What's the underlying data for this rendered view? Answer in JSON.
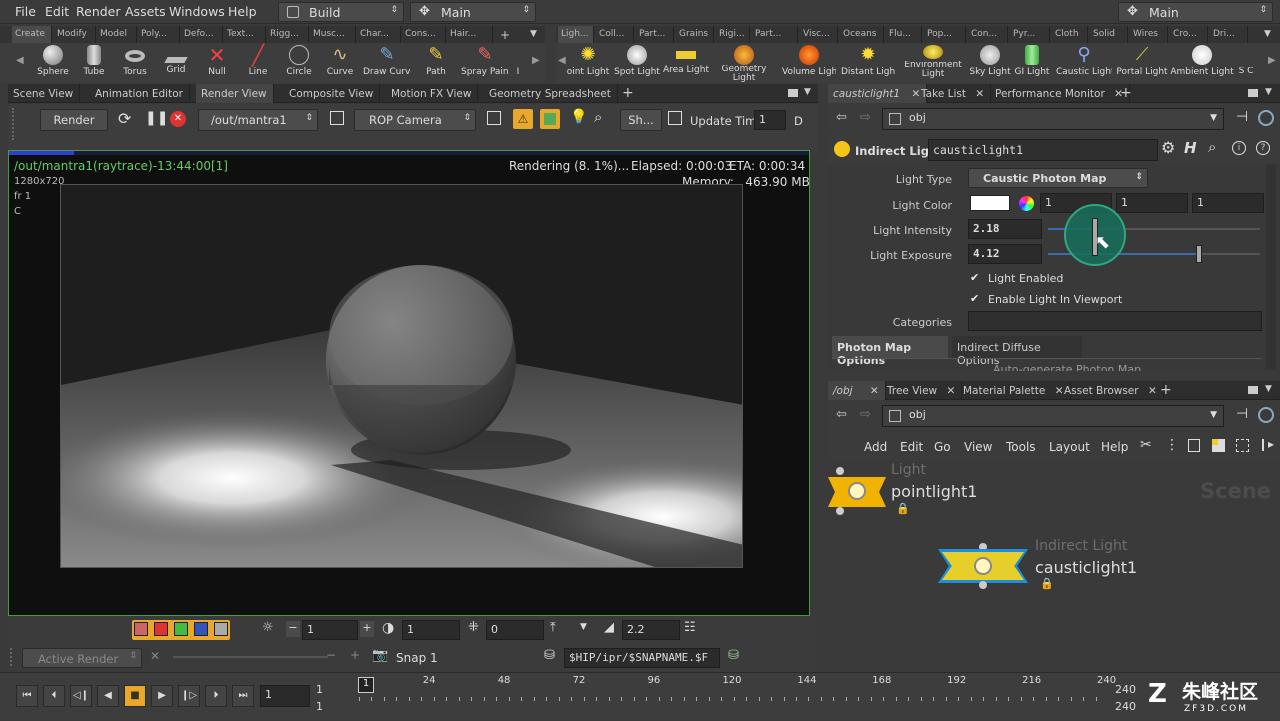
{
  "menubar": {
    "items": [
      "File",
      "Edit",
      "Render",
      "Assets",
      "Windows",
      "Help"
    ],
    "desktop1": "Build",
    "desktop2": "Main",
    "desktop3": "Main"
  },
  "shelf_left": {
    "tabs": [
      "Create",
      "Modify",
      "Model",
      "Poly...",
      "Defo...",
      "Text...",
      "Rigg...",
      "Musc...",
      "Char...",
      "Cons...",
      "Hair..."
    ],
    "tools": [
      "Sphere",
      "Tube",
      "Torus",
      "Grid",
      "Null",
      "Line",
      "Circle",
      "Curve",
      "Draw Curve",
      "Path",
      "Spray Paint",
      "I"
    ]
  },
  "shelf_right": {
    "tabs": [
      "Ligh...",
      "Coll...",
      "Part...",
      "Grains",
      "Rigi...",
      "Part...",
      "Visc...",
      "Oceans",
      "Flu...",
      "Pop...",
      "Con...",
      "Pyr...",
      "Cloth",
      "Solid",
      "Wires",
      "Cro...",
      "Dri..."
    ],
    "tools": [
      "oint Light",
      "Spot Light",
      "Area Light",
      "Geometry Light",
      "Volume Light",
      "Distant Light",
      "Environment Light",
      "Sky Light",
      "GI Light",
      "Caustic Light",
      "Portal Light",
      "Ambient Light",
      "S C"
    ]
  },
  "left_tabs": [
    "Scene View",
    "Animation Editor",
    "Render View",
    "Composite View",
    "Motion FX View",
    "Geometry Spreadsheet"
  ],
  "render_toolbar": {
    "render_btn": "Render",
    "rop_path": "/out/mantra1",
    "camera": "ROP Camera",
    "sh_btn": "Sh...",
    "update_time_label": "Update Time",
    "update_time_value": "1",
    "d_label": "D"
  },
  "render_view": {
    "title": "/out/mantra1(raytrace)-13:44:00[1]",
    "resolution": "1280x720",
    "frame": "fr 1",
    "channel": "C",
    "status": "Rendering (8. 1%)...",
    "elapsed": "Elapsed: 0:00:03",
    "eta": "ETA: 0:00:34",
    "memory": "Memory:   463.90 MB",
    "progress": 0.081
  },
  "render_bottom": {
    "val1": "1",
    "val2": "1",
    "val3": "0",
    "gamma": "2.2",
    "active_render": "Active Render",
    "snap": "Snap 1",
    "snapname": "$HIP/ipr/$SNAPNAME.$F"
  },
  "right_top_tabs": [
    "causticlight1",
    "Take List",
    "Performance Monitor"
  ],
  "path_top": "obj",
  "parms": {
    "node_type": "Indirect Light",
    "node_name": "causticlight1",
    "rows": [
      {
        "label": "Light Type",
        "value": "Caustic Photon Map"
      },
      {
        "label": "Light Color",
        "value": ""
      },
      {
        "label": "Light Intensity",
        "value": "2.18"
      },
      {
        "label": "Light Exposure",
        "value": "4.12"
      }
    ],
    "color_values": [
      "1",
      "1",
      "1"
    ],
    "intensity_slider": 0.22,
    "exposure_slider": 0.71,
    "checkboxes": [
      "Light Enabled",
      "Enable Light In Viewport"
    ],
    "categories_label": "Categories",
    "subtabs": [
      "Photon Map Options",
      "Indirect Diffuse Options"
    ],
    "cut_row": "Auto-generate Photon Map"
  },
  "right_bottom_tabs": [
    "/obj",
    "Tree View",
    "Material Palette",
    "Asset Browser"
  ],
  "path_bottom": "obj",
  "network_menu": [
    "Add",
    "Edit",
    "Go",
    "View",
    "Tools",
    "Layout",
    "Help"
  ],
  "network": {
    "watermark": "Scene",
    "nodes": [
      {
        "type": "Light",
        "name": "pointlight1"
      },
      {
        "type": "Indirect Light",
        "name": "causticlight1"
      }
    ]
  },
  "timeline": {
    "current_frame": "1",
    "start": "1",
    "start2": "1",
    "ticks": [
      "1",
      "24",
      "48",
      "72",
      "96",
      "120",
      "144",
      "168",
      "192",
      "216",
      "240"
    ],
    "end": "240",
    "end2": "240"
  },
  "watermark": {
    "text": "朱峰社区",
    "sub": "ZF3D.COM"
  },
  "colors": {
    "accent": "#f2a000",
    "node_yellow": "#f5c518",
    "render_green": "#3f9e3f",
    "cursor_ring": "#1f8a6a"
  }
}
